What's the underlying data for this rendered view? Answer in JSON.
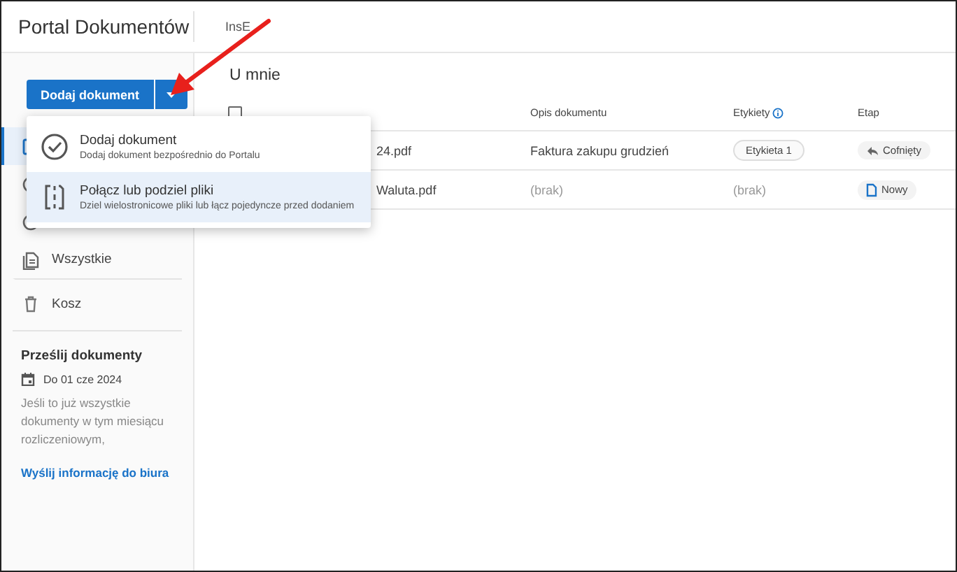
{
  "header": {
    "title": "Portal Dokumentów",
    "company": "InsE"
  },
  "add_button": {
    "label": "Dodaj dokument"
  },
  "dropdown_menu": [
    {
      "kind": "check",
      "title": "Dodaj dokument",
      "subtitle": "Dodaj dokument bezpośrednio do Portalu",
      "selected": false
    },
    {
      "kind": "split",
      "title": "Połącz lub podziel pliki",
      "subtitle": "Dziel wielostronicowe pliki lub łącz pojedyncze przed dodaniem",
      "selected": true
    }
  ],
  "sidebar": {
    "items": [
      {
        "kind": "inbox",
        "selected": true
      },
      {
        "kind": "clock",
        "selected": false
      },
      {
        "kind": "done",
        "selected": false
      },
      {
        "kind": "all",
        "label": "Wszystkie",
        "selected": false
      },
      {
        "kind": "trash",
        "label": "Kosz",
        "selected": false
      }
    ],
    "send": {
      "title": "Prześlij dokumenty",
      "deadline": "Do 01 cze 2024",
      "text": "Jeśli to już wszystkie dokumenty w tym miesiącu rozliczeniowym,",
      "link": "Wyślij informację do biura"
    }
  },
  "main": {
    "title": "U mnie",
    "table": {
      "select_all": {
        "checked": false
      },
      "columns": [
        "Opis dokumentu",
        "Etykiety",
        "Etap"
      ],
      "rows": [
        {
          "name": "24.pdf",
          "description": "Faktura zakupu grudzień",
          "muted": false,
          "labels": {
            "kind": "chip",
            "text": "Etykieta 1"
          },
          "stage": {
            "kind": "back",
            "text": "Cofnięty"
          }
        },
        {
          "name": "Waluta.pdf",
          "description": "(brak)",
          "muted": true,
          "labels": {
            "kind": "empty",
            "text": "(brak)"
          },
          "stage": {
            "kind": "new",
            "text": "Nowy"
          }
        }
      ]
    }
  }
}
